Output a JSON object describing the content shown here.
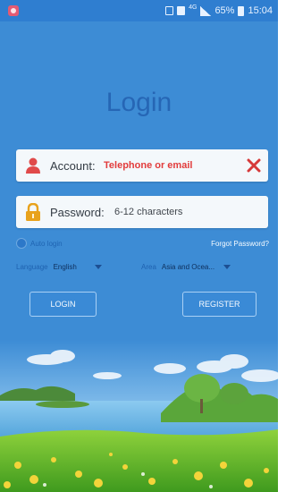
{
  "status_bar": {
    "network": "4G",
    "battery": "65%",
    "time": "15:04"
  },
  "login": {
    "title": "Login",
    "account_label": "Account:",
    "account_placeholder": "Telephone or email",
    "password_label": "Password:",
    "password_placeholder": "6-12 characters",
    "auto_login_label": "Auto login",
    "forgot_password_label": "Forgot Password?",
    "language_label": "Language",
    "language_value": "English",
    "area_label": "Area",
    "area_value": "Asia and Ocea...",
    "login_button": "LOGIN",
    "register_button": "REGISTER"
  },
  "colors": {
    "background": "#3d8cd5",
    "title": "#2666b5",
    "account_placeholder": "#e23c3c",
    "user_icon": "#e04a4a",
    "lock_icon": "#e8a21c",
    "clear_icon": "#d63a3a"
  },
  "icons": {
    "app": "app-notification-icon",
    "user": "user-icon",
    "lock": "lock-icon",
    "clear": "close-icon"
  }
}
